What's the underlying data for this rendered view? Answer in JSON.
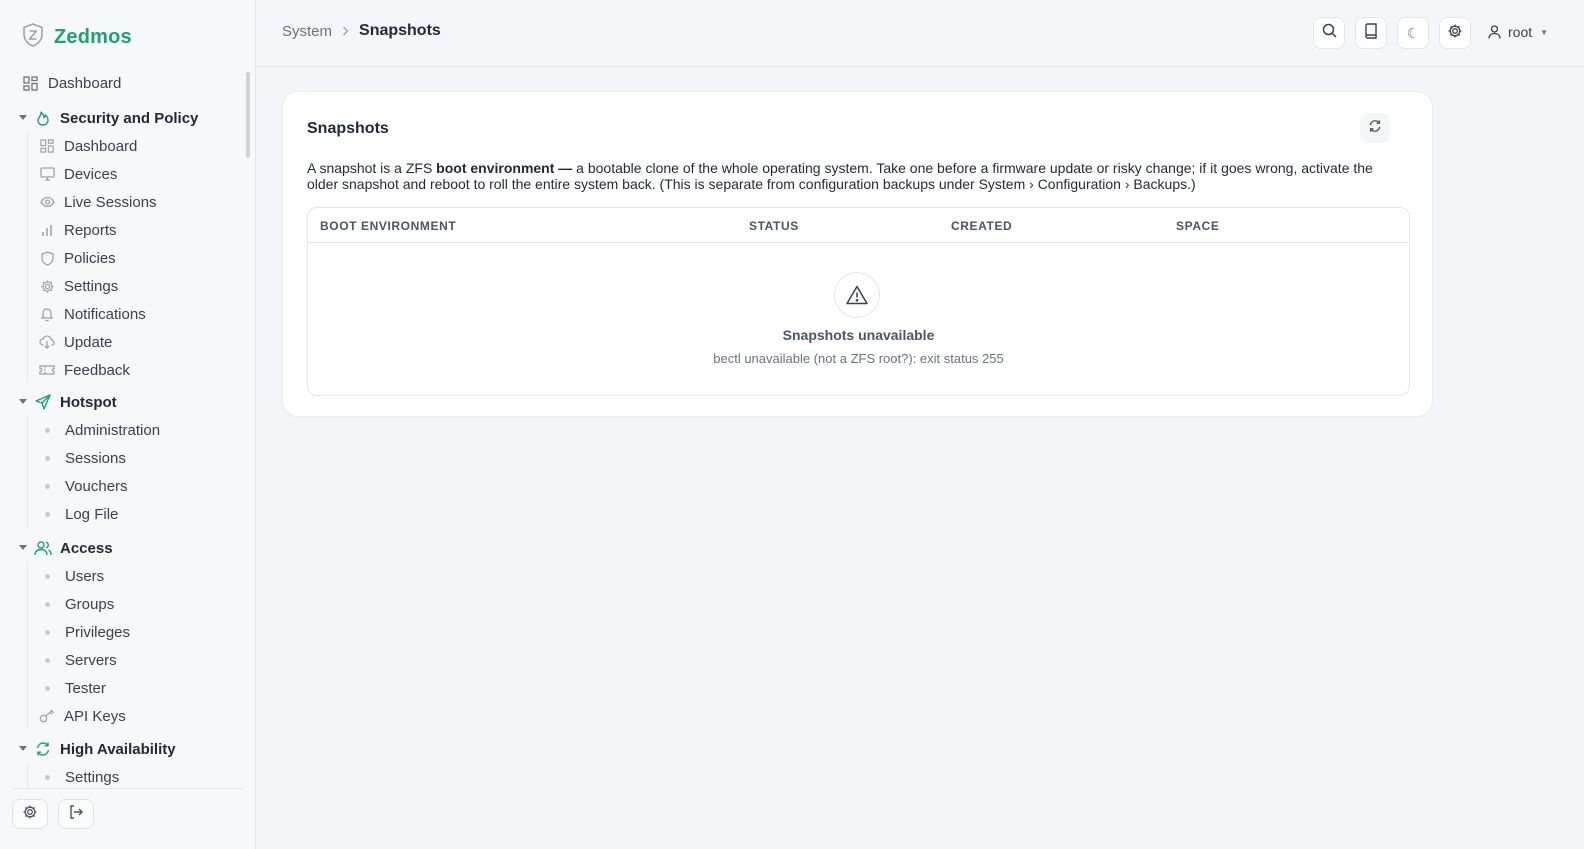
{
  "brand": {
    "name": "Zedmos"
  },
  "sidebar": {
    "top_item": {
      "label": "Dashboard",
      "icon": "grid-icon"
    },
    "sections": [
      {
        "label": "Security and Policy",
        "icon": "flame-icon",
        "items": [
          {
            "label": "Dashboard",
            "icon": "grid-icon"
          },
          {
            "label": "Devices",
            "icon": "monitor-icon"
          },
          {
            "label": "Live Sessions",
            "icon": "eye-icon"
          },
          {
            "label": "Reports",
            "icon": "bar-chart-icon"
          },
          {
            "label": "Policies",
            "icon": "shield-icon"
          },
          {
            "label": "Settings",
            "icon": "gear-icon"
          },
          {
            "label": "Notifications",
            "icon": "bell-icon"
          },
          {
            "label": "Update",
            "icon": "cloud-download-icon"
          },
          {
            "label": "Feedback",
            "icon": "ticket-icon"
          }
        ]
      },
      {
        "label": "Hotspot",
        "icon": "send-icon",
        "items": [
          {
            "label": "Administration"
          },
          {
            "label": "Sessions"
          },
          {
            "label": "Vouchers"
          },
          {
            "label": "Log File"
          }
        ]
      },
      {
        "label": "Access",
        "icon": "users-icon",
        "items": [
          {
            "label": "Users"
          },
          {
            "label": "Groups"
          },
          {
            "label": "Privileges"
          },
          {
            "label": "Servers"
          },
          {
            "label": "Tester"
          },
          {
            "label": "API Keys",
            "icon": "key-icon"
          }
        ]
      },
      {
        "label": "High Availability",
        "icon": "refresh-icon",
        "items": [
          {
            "label": "Settings"
          }
        ]
      }
    ],
    "footer": {
      "settings_icon": "gear-icon",
      "logout_icon": "logout-icon"
    }
  },
  "header": {
    "breadcrumb": {
      "parent": "System",
      "current": "Snapshots"
    },
    "user": "root",
    "buttons": [
      "search-icon",
      "book-icon",
      "moon-icon",
      "gear-icon"
    ]
  },
  "card": {
    "title": "Snapshots",
    "refresh_icon": "refresh-icon",
    "description": {
      "before": "A snapshot is a ZFS ",
      "bold": "boot environment —",
      "after": " a bootable clone of the whole operating system. Take one before a firmware update or risky change; if it goes wrong, activate the older snapshot and reboot to roll the entire system back. (This is separate from configuration backups under System › Configuration › Backups.)"
    },
    "table": {
      "columns": [
        "BOOT ENVIRONMENT",
        "STATUS",
        "CREATED",
        "SPACE"
      ],
      "rows": [],
      "empty": {
        "icon": "warning-icon",
        "title": "Snapshots unavailable",
        "message": "bectl unavailable (not a ZFS root?): exit status 255"
      }
    }
  },
  "colors": {
    "accent": "#1aa36f",
    "background": "#f3f5f8",
    "card": "#ffffff"
  }
}
